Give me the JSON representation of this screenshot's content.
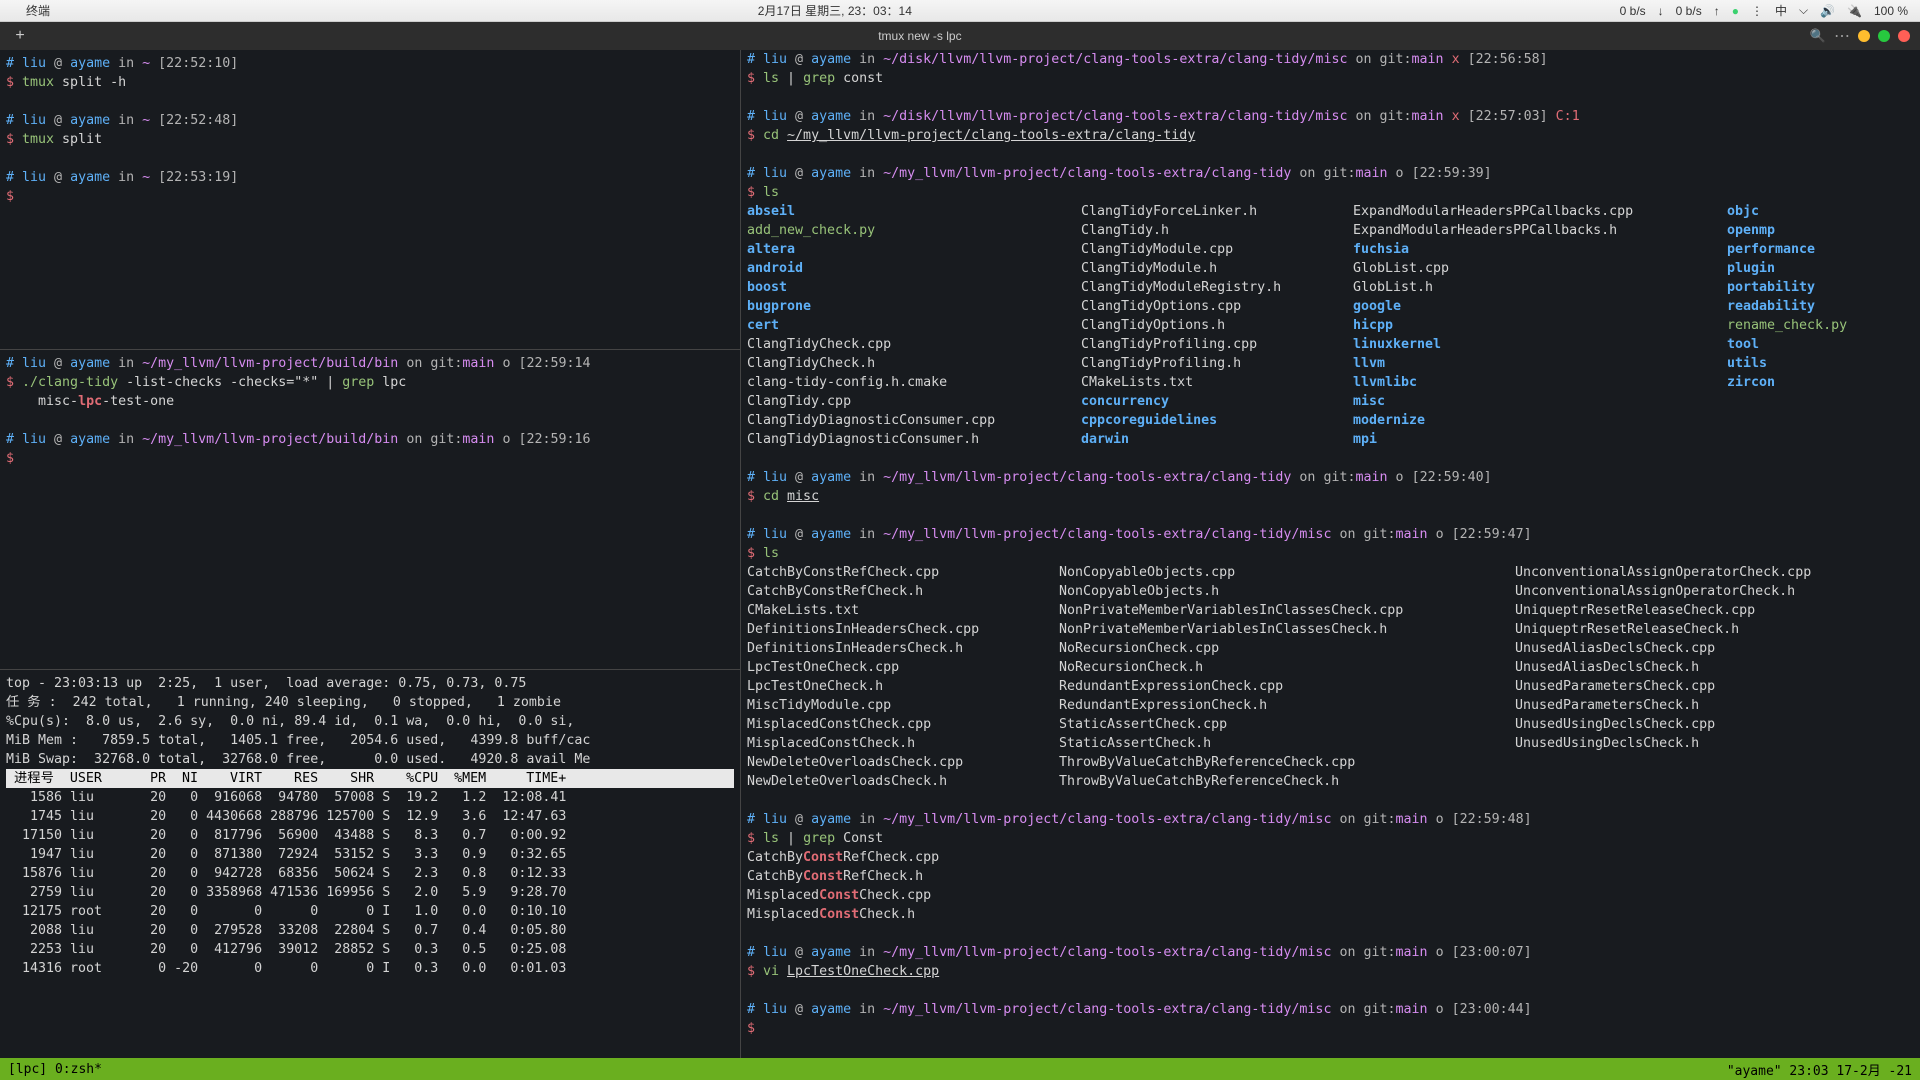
{
  "menubar": {
    "app": "终端",
    "date": "2月17日 星期三, 23：03：14",
    "net_down": "0 b/s",
    "net_up": "0 b/s",
    "ime": "中",
    "battery": "100 %"
  },
  "titlebar": {
    "title": "tmux new -s lpc"
  },
  "left_top": {
    "lines": [
      {
        "type": "prompt",
        "user": "liu",
        "host": "ayame",
        "path": "~",
        "ts": "[22:52:10]"
      },
      {
        "type": "cmd",
        "text": "tmux split -h",
        "green": "tmux"
      },
      "",
      {
        "type": "prompt",
        "user": "liu",
        "host": "ayame",
        "path": "~",
        "ts": "[22:52:48]"
      },
      {
        "type": "cmd",
        "text": "tmux split",
        "green": "tmux"
      },
      "",
      {
        "type": "prompt",
        "user": "liu",
        "host": "ayame",
        "path": "~",
        "ts": "[22:53:19]"
      },
      {
        "type": "dollar"
      }
    ]
  },
  "left_mid": {
    "lines": [
      {
        "type": "prompt",
        "user": "liu",
        "host": "ayame",
        "path": "~/my_llvm/llvm-project/build/bin",
        "branch": "main",
        "o": "o",
        "ts": "[22:59:14"
      },
      {
        "type": "cmd_complex",
        "parts": [
          {
            "t": "$ ",
            "c": "dollar"
          },
          {
            "t": "./clang-tidy",
            "c": "cmd-green"
          },
          {
            "t": " -list-checks -checks=\"*\" | ",
            "c": "cmd"
          },
          {
            "t": "grep",
            "c": "cmd-green"
          },
          {
            "t": " lpc",
            "c": "cmd"
          }
        ]
      },
      {
        "type": "raw",
        "text": "    misc-lpc-test-one",
        "hl": "lpc"
      },
      "",
      {
        "type": "prompt",
        "user": "liu",
        "host": "ayame",
        "path": "~/my_llvm/llvm-project/build/bin",
        "branch": "main",
        "o": "o",
        "ts": "[22:59:16"
      },
      {
        "type": "dollar"
      }
    ]
  },
  "top_output": {
    "header": [
      "top - 23:03:13 up  2:25,  1 user,  load average: 0.75, 0.73, 0.75",
      "任 务 :  242 total,   1 running, 240 sleeping,   0 stopped,   1 zombie",
      "%Cpu(s):  8.0 us,  2.6 sy,  0.0 ni, 89.4 id,  0.1 wa,  0.0 hi,  0.0 si,",
      "MiB Mem :   7859.5 total,   1405.1 free,   2054.6 used,   4399.8 buff/cac",
      "MiB Swap:  32768.0 total,  32768.0 free,      0.0 used.   4920.8 avail Me"
    ],
    "cols": " 进程号  USER      PR  NI    VIRT    RES    SHR    %CPU  %MEM     TIME+",
    "rows": [
      "   1586 liu       20   0  916068  94780  57008 S  19.2   1.2  12:08.41",
      "   1745 liu       20   0 4430668 288796 125700 S  12.9   3.6  12:47.63",
      "  17150 liu       20   0  817796  56900  43488 S   8.3   0.7   0:00.92",
      "   1947 liu       20   0  871380  72924  53152 S   3.3   0.9   0:32.65",
      "  15876 liu       20   0  942728  68356  50624 S   2.3   0.8   0:12.33",
      "   2759 liu       20   0 3358968 471536 169956 S   2.0   5.9   9:28.70",
      "  12175 root      20   0       0      0      0 I   1.0   0.0   0:10.10",
      "   2088 liu       20   0  279528  33208  22804 S   0.7   0.4   0:05.80",
      "   2253 liu       20   0  412796  39012  28852 S   0.3   0.5   0:25.08",
      "  14316 root       0 -20       0      0      0 I   0.3   0.0   0:01.03"
    ]
  },
  "right_pane": {
    "blocks": [
      {
        "type": "prompt",
        "user": "liu",
        "host": "ayame",
        "path": "~/disk/llvm/llvm-project/clang-tools-extra/clang-tidy/misc",
        "branch": "main",
        "x": "x",
        "ts": "[22:56:58]"
      },
      {
        "type": "cmd_complex",
        "parts": [
          {
            "t": "$ ",
            "c": "dollar"
          },
          {
            "t": "ls",
            "c": "cmd-green"
          },
          {
            "t": " | ",
            "c": "cmd"
          },
          {
            "t": "grep",
            "c": "cmd-green"
          },
          {
            "t": " const",
            "c": "cmd"
          }
        ]
      },
      "",
      {
        "type": "prompt",
        "user": "liu",
        "host": "ayame",
        "path": "~/disk/llvm/llvm-project/clang-tools-extra/clang-tidy/misc",
        "branch": "main",
        "x": "x",
        "ts": "[22:57:03]",
        "extra": " C:1"
      },
      {
        "type": "cmd_complex",
        "parts": [
          {
            "t": "$ ",
            "c": "dollar"
          },
          {
            "t": "cd",
            "c": "cmd-green"
          },
          {
            "t": " ",
            "c": "cmd"
          },
          {
            "t": "~/my_llvm/llvm-project/clang-tools-extra/clang-tidy",
            "c": "cmd underline"
          }
        ]
      },
      "",
      {
        "type": "prompt",
        "user": "liu",
        "host": "ayame",
        "path": "~/my_llvm/llvm-project/clang-tools-extra/clang-tidy",
        "branch": "main",
        "o": "o",
        "ts": "[22:59:39]"
      },
      {
        "type": "cmd_complex",
        "parts": [
          {
            "t": "$ ",
            "c": "dollar"
          },
          {
            "t": "ls",
            "c": "cmd-green"
          }
        ]
      },
      {
        "type": "ls4"
      },
      "",
      {
        "type": "prompt",
        "user": "liu",
        "host": "ayame",
        "path": "~/my_llvm/llvm-project/clang-tools-extra/clang-tidy",
        "branch": "main",
        "o": "o",
        "ts": "[22:59:40]"
      },
      {
        "type": "cmd_complex",
        "parts": [
          {
            "t": "$ ",
            "c": "dollar"
          },
          {
            "t": "cd",
            "c": "cmd-green"
          },
          {
            "t": " ",
            "c": "cmd"
          },
          {
            "t": "misc",
            "c": "cmd underline"
          }
        ]
      },
      "",
      {
        "type": "prompt",
        "user": "liu",
        "host": "ayame",
        "path": "~/my_llvm/llvm-project/clang-tools-extra/clang-tidy/misc",
        "branch": "main",
        "o": "o",
        "ts": "[22:59:47]"
      },
      {
        "type": "cmd_complex",
        "parts": [
          {
            "t": "$ ",
            "c": "dollar"
          },
          {
            "t": "ls",
            "c": "cmd-green"
          }
        ]
      },
      {
        "type": "ls3"
      },
      "",
      {
        "type": "prompt",
        "user": "liu",
        "host": "ayame",
        "path": "~/my_llvm/llvm-project/clang-tools-extra/clang-tidy/misc",
        "branch": "main",
        "o": "o",
        "ts": "[22:59:48]"
      },
      {
        "type": "cmd_complex",
        "parts": [
          {
            "t": "$ ",
            "c": "dollar"
          },
          {
            "t": "ls",
            "c": "cmd-green"
          },
          {
            "t": " | ",
            "c": "cmd"
          },
          {
            "t": "grep",
            "c": "cmd-green"
          },
          {
            "t": " Const",
            "c": "cmd"
          }
        ]
      },
      {
        "type": "raw",
        "text": "CatchByConstRefCheck.cpp",
        "hl": "Const"
      },
      {
        "type": "raw",
        "text": "CatchByConstRefCheck.h",
        "hl": "Const"
      },
      {
        "type": "raw",
        "text": "MisplacedConstCheck.cpp",
        "hl": "Const"
      },
      {
        "type": "raw",
        "text": "MisplacedConstCheck.h",
        "hl": "Const"
      },
      "",
      {
        "type": "prompt",
        "user": "liu",
        "host": "ayame",
        "path": "~/my_llvm/llvm-project/clang-tools-extra/clang-tidy/misc",
        "branch": "main",
        "o": "o",
        "ts": "[23:00:07]"
      },
      {
        "type": "cmd_complex",
        "parts": [
          {
            "t": "$ ",
            "c": "dollar"
          },
          {
            "t": "vi",
            "c": "cmd-green"
          },
          {
            "t": " ",
            "c": "cmd"
          },
          {
            "t": "LpcTestOneCheck.cpp",
            "c": "cmd underline"
          }
        ]
      },
      "",
      {
        "type": "prompt",
        "user": "liu",
        "host": "ayame",
        "path": "~/my_llvm/llvm-project/clang-tools-extra/clang-tidy/misc",
        "branch": "main",
        "o": "o",
        "ts": "[23:00:44]"
      },
      {
        "type": "dollar"
      }
    ],
    "ls4": {
      "col0": [
        {
          "t": "abseil",
          "c": "dir"
        },
        {
          "t": "add_new_check.py",
          "c": "pyfile"
        },
        {
          "t": "altera",
          "c": "dir"
        },
        {
          "t": "android",
          "c": "dir"
        },
        {
          "t": "boost",
          "c": "dir"
        },
        {
          "t": "bugprone",
          "c": "dir"
        },
        {
          "t": "cert",
          "c": "dir"
        },
        {
          "t": "ClangTidyCheck.cpp",
          "c": "plain"
        },
        {
          "t": "ClangTidyCheck.h",
          "c": "plain"
        },
        {
          "t": "clang-tidy-config.h.cmake",
          "c": "plain"
        },
        {
          "t": "ClangTidy.cpp",
          "c": "plain"
        },
        {
          "t": "ClangTidyDiagnosticConsumer.cpp",
          "c": "plain"
        },
        {
          "t": "ClangTidyDiagnosticConsumer.h",
          "c": "plain"
        }
      ],
      "col1": [
        {
          "t": "ClangTidyForceLinker.h",
          "c": "plain"
        },
        {
          "t": "ClangTidy.h",
          "c": "plain"
        },
        {
          "t": "ClangTidyModule.cpp",
          "c": "plain"
        },
        {
          "t": "ClangTidyModule.h",
          "c": "plain"
        },
        {
          "t": "ClangTidyModuleRegistry.h",
          "c": "plain"
        },
        {
          "t": "ClangTidyOptions.cpp",
          "c": "plain"
        },
        {
          "t": "ClangTidyOptions.h",
          "c": "plain"
        },
        {
          "t": "ClangTidyProfiling.cpp",
          "c": "plain"
        },
        {
          "t": "ClangTidyProfiling.h",
          "c": "plain"
        },
        {
          "t": "CMakeLists.txt",
          "c": "plain"
        },
        {
          "t": "concurrency",
          "c": "dir"
        },
        {
          "t": "cppcoreguidelines",
          "c": "dir"
        },
        {
          "t": "darwin",
          "c": "dir"
        }
      ],
      "col2": [
        {
          "t": "ExpandModularHeadersPPCallbacks.cpp",
          "c": "plain"
        },
        {
          "t": "ExpandModularHeadersPPCallbacks.h",
          "c": "plain"
        },
        {
          "t": "fuchsia",
          "c": "dir"
        },
        {
          "t": "GlobList.cpp",
          "c": "plain"
        },
        {
          "t": "GlobList.h",
          "c": "plain"
        },
        {
          "t": "google",
          "c": "dir"
        },
        {
          "t": "hicpp",
          "c": "dir"
        },
        {
          "t": "linuxkernel",
          "c": "dir"
        },
        {
          "t": "llvm",
          "c": "dir"
        },
        {
          "t": "llvmlibc",
          "c": "dir"
        },
        {
          "t": "misc",
          "c": "dir"
        },
        {
          "t": "modernize",
          "c": "dir"
        },
        {
          "t": "mpi",
          "c": "dir"
        }
      ],
      "col3": [
        {
          "t": "objc",
          "c": "dir"
        },
        {
          "t": "openmp",
          "c": "dir"
        },
        {
          "t": "performance",
          "c": "dir"
        },
        {
          "t": "plugin",
          "c": "dir"
        },
        {
          "t": "portability",
          "c": "dir"
        },
        {
          "t": "readability",
          "c": "dir"
        },
        {
          "t": "rename_check.py",
          "c": "pyfile"
        },
        {
          "t": "tool",
          "c": "dir"
        },
        {
          "t": "utils",
          "c": "dir"
        },
        {
          "t": "zircon",
          "c": "dir"
        }
      ]
    },
    "ls3": {
      "col0": [
        "CatchByConstRefCheck.cpp",
        "CatchByConstRefCheck.h",
        "CMakeLists.txt",
        "DefinitionsInHeadersCheck.cpp",
        "DefinitionsInHeadersCheck.h",
        "LpcTestOneCheck.cpp",
        "LpcTestOneCheck.h",
        "MiscTidyModule.cpp",
        "MisplacedConstCheck.cpp",
        "MisplacedConstCheck.h",
        "NewDeleteOverloadsCheck.cpp",
        "NewDeleteOverloadsCheck.h"
      ],
      "col1": [
        "NonCopyableObjects.cpp",
        "NonCopyableObjects.h",
        "NonPrivateMemberVariablesInClassesCheck.cpp",
        "NonPrivateMemberVariablesInClassesCheck.h",
        "NoRecursionCheck.cpp",
        "NoRecursionCheck.h",
        "RedundantExpressionCheck.cpp",
        "RedundantExpressionCheck.h",
        "StaticAssertCheck.cpp",
        "StaticAssertCheck.h",
        "ThrowByValueCatchByReferenceCheck.cpp",
        "ThrowByValueCatchByReferenceCheck.h"
      ],
      "col2": [
        "UnconventionalAssignOperatorCheck.cpp",
        "UnconventionalAssignOperatorCheck.h",
        "UniqueptrResetReleaseCheck.cpp",
        "UniqueptrResetReleaseCheck.h",
        "UnusedAliasDeclsCheck.cpp",
        "UnusedAliasDeclsCheck.h",
        "UnusedParametersCheck.cpp",
        "UnusedParametersCheck.h",
        "UnusedUsingDeclsCheck.cpp",
        "UnusedUsingDeclsCheck.h"
      ]
    }
  },
  "statusbar": {
    "left": "[lpc] 0:zsh*",
    "right": "\"ayame\" 23:03 17-2月 -21"
  }
}
